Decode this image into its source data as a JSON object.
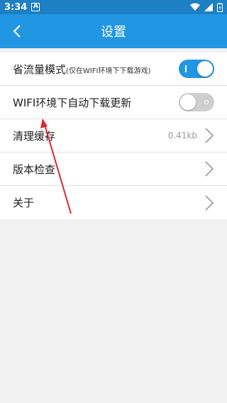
{
  "status_bar": {
    "time": "3:34",
    "notification_glyph": "A"
  },
  "app_bar": {
    "title": "设置"
  },
  "settings": [
    {
      "label": "省流量模式",
      "sublabel": "(仅在WIFI环境下下载游戏)",
      "control": "toggle",
      "state": "on"
    },
    {
      "label": "WIFI环境下自动下载更新",
      "control": "toggle",
      "state": "off"
    },
    {
      "label": "清理缓存",
      "value": "0.41kb",
      "control": "chevron"
    },
    {
      "label": "版本检查",
      "control": "chevron"
    },
    {
      "label": "关于",
      "control": "chevron"
    }
  ],
  "colors": {
    "accent": "#2196e3",
    "status_bar": "#1d7fc4",
    "annotation_arrow": "#e0262b"
  }
}
